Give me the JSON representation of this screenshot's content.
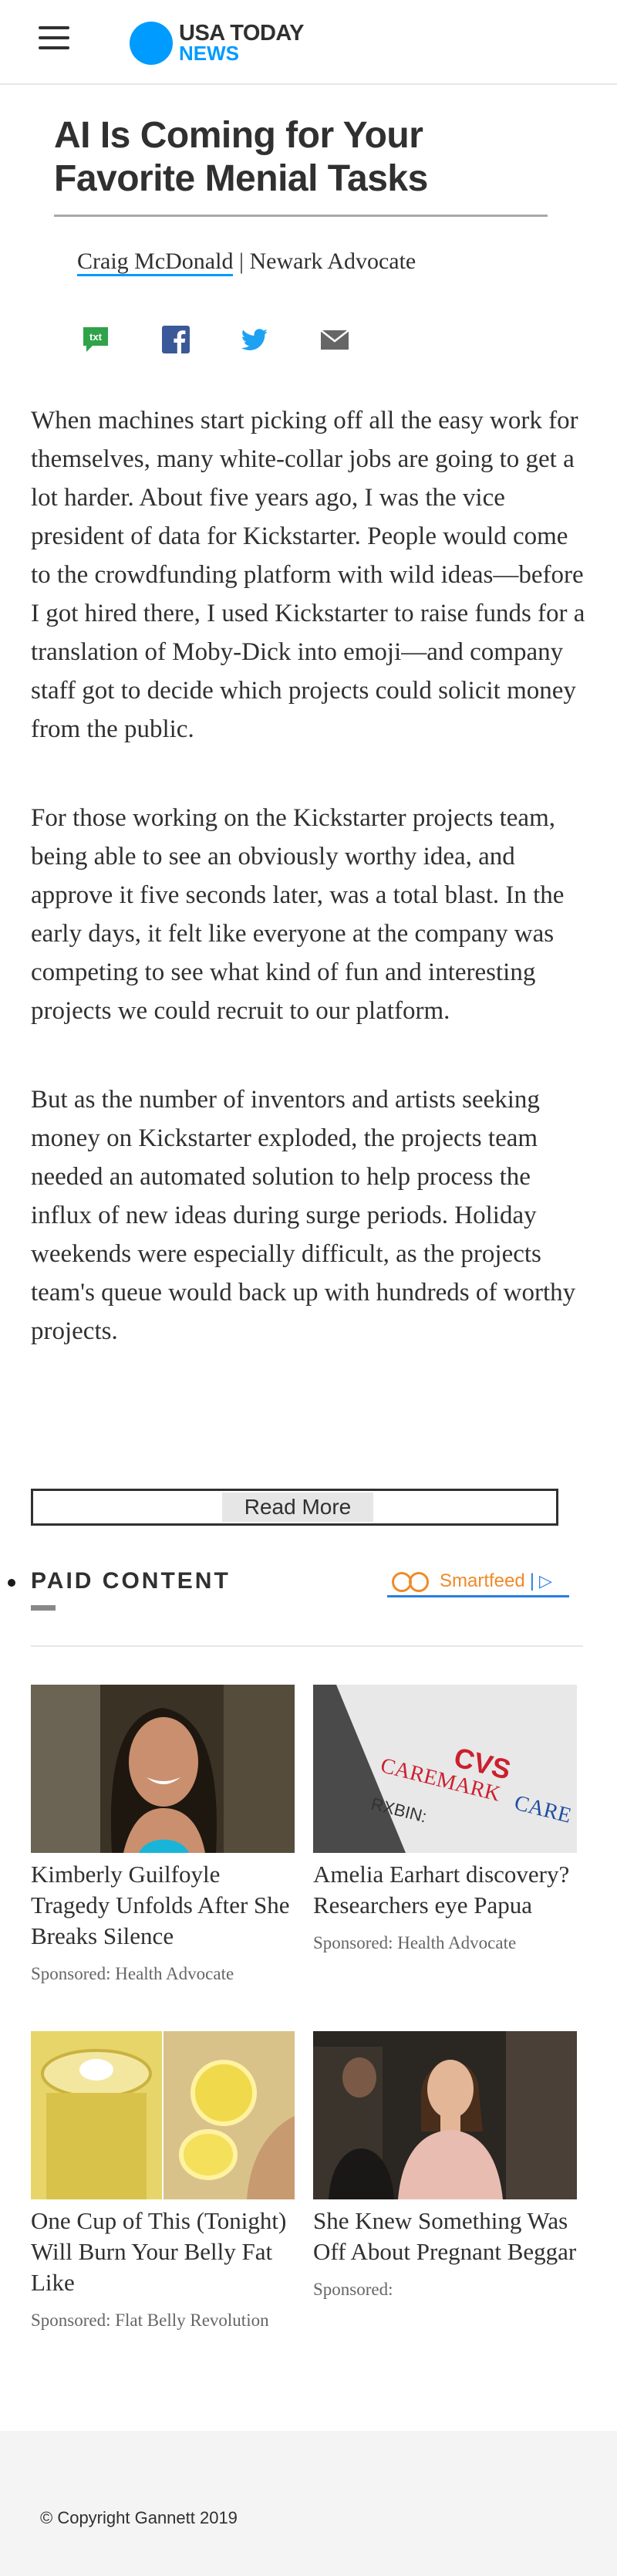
{
  "header": {
    "brand_top": "USA TODAY",
    "brand_bottom": "NEWS",
    "brand_color": "#009bff"
  },
  "article": {
    "title": "AI Is Coming for Your Favorite Menial Tasks",
    "author": "Craig McDonald",
    "separator": " | ",
    "publication": "Newark Advocate",
    "share_icons": [
      "txt-icon",
      "facebook-icon",
      "twitter-icon",
      "email-icon"
    ],
    "share_txt_label": "txt",
    "paragraphs": [
      "When machines start picking off all the easy work for themselves, many white-collar jobs are going to get a lot harder. About five years ago, I was the vice president of data for Kickstarter. People would come to the crowdfunding platform with wild ideas—before I got hired there, I used Kickstarter to raise funds for a translation of Moby-Dick into emoji—and company staff got to decide which projects could solicit money from the public.",
      "For those working on the Kickstarter projects team, being able to see an obviously worthy idea, and approve it five seconds later, was a total blast. In the early days, it felt like everyone at the company was competing to see what kind of fun and interesting projects we could recruit to our platform.",
      "But as the number of inventors and artists seeking money on Kickstarter exploded, the projects team needed an automated solution to help process the influx of new ideas during surge periods. Holiday weekends were especially difficult, as the projects team's queue would back up with hundreds of worthy projects."
    ],
    "read_more_label": "Read More"
  },
  "paid_content": {
    "heading": "PAID CONTENT",
    "provider": "Smartfeed",
    "cards": [
      {
        "title": "Kimberly Guilfoyle Tragedy Unfolds After She Breaks Silence",
        "sponsor": "Sponsored: Health Advocate"
      },
      {
        "title": "Amelia Earhart discovery? Researchers eye Papua",
        "sponsor": "Sponsored: Health Advocate",
        "image_text_1": "CVS",
        "image_text_2": "CAREMARK",
        "image_text_3": "CARE",
        "image_text_4": "RXBIN:"
      },
      {
        "title": "One Cup of This (Tonight) Will Burn Your Belly Fat Like",
        "sponsor": "Sponsored: Flat Belly Revolution"
      },
      {
        "title": "She Knew Something Was Off About Pregnant Beggar",
        "sponsor": "Sponsored:"
      }
    ]
  },
  "footer": {
    "copyright": "© Copyright Gannett 2019"
  }
}
